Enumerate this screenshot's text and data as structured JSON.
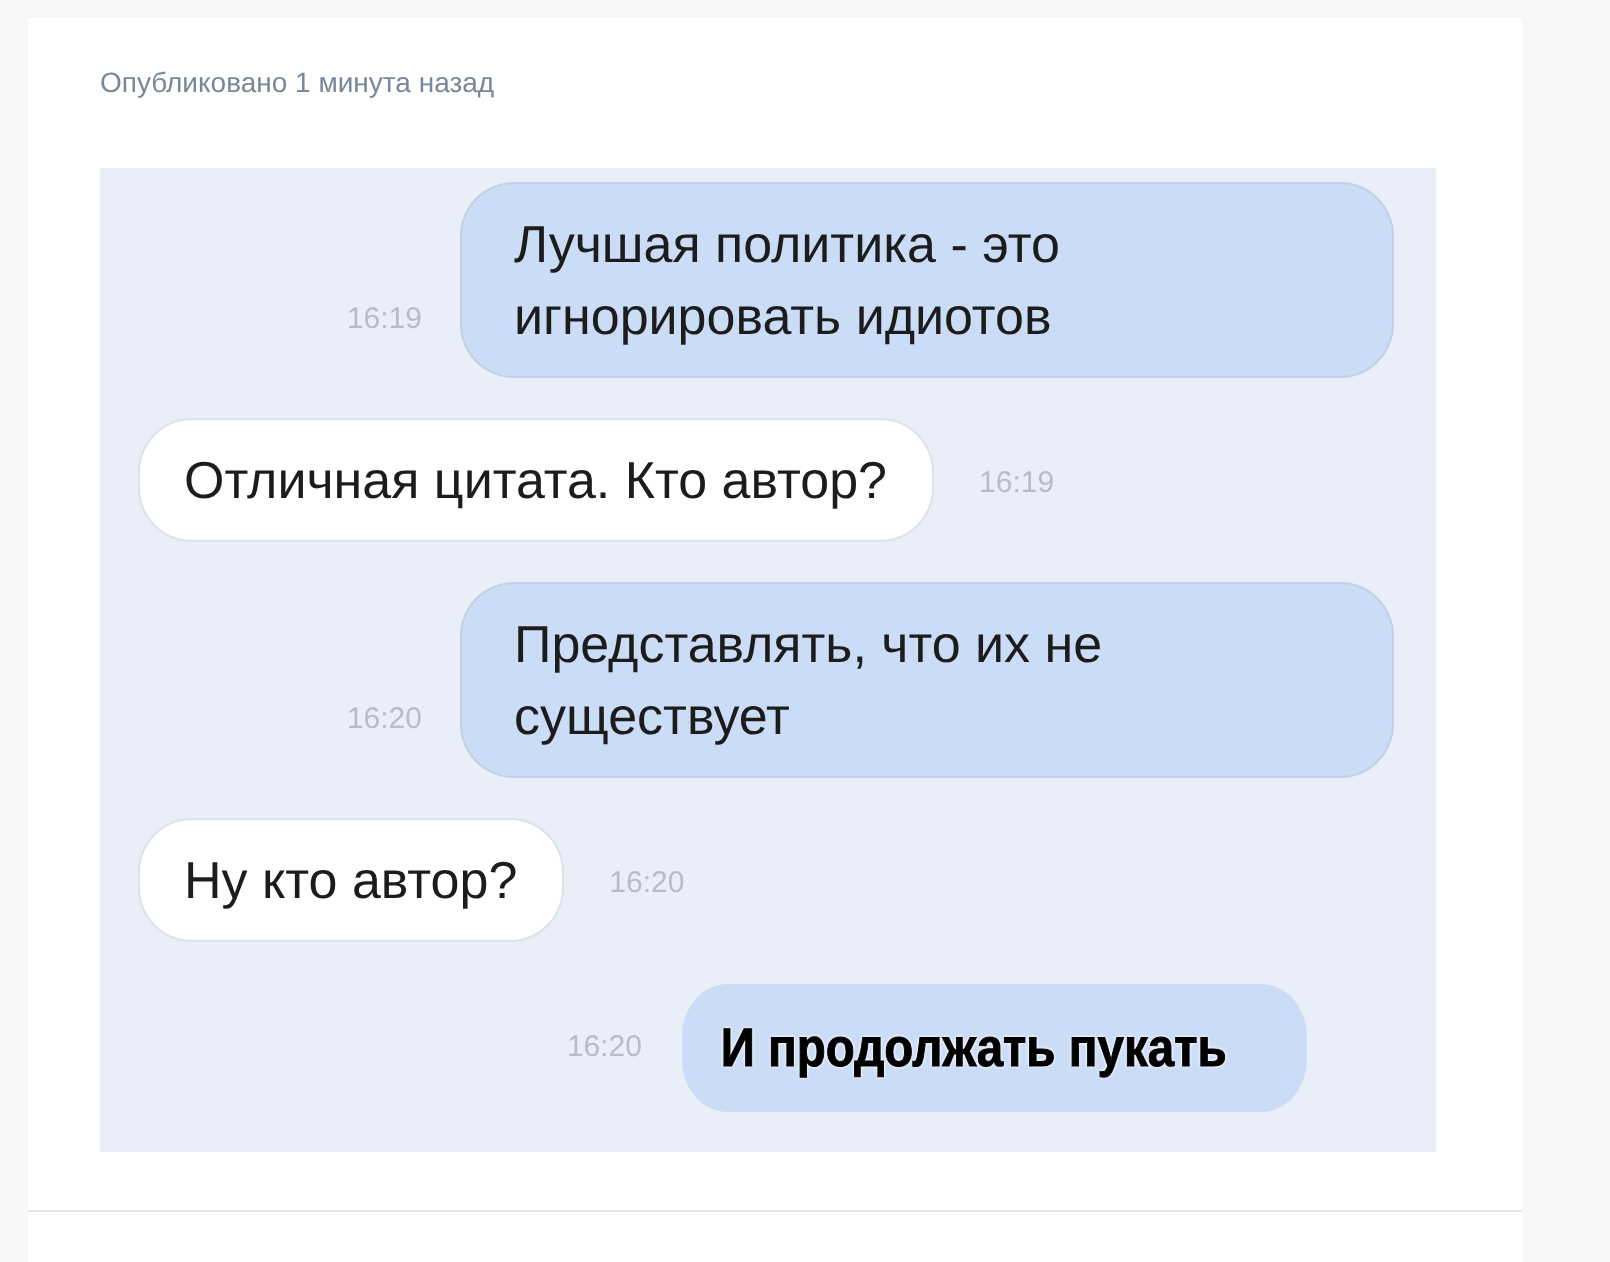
{
  "post": {
    "published": "Опубликовано 1 минута назад"
  },
  "messages": [
    {
      "kind": "sent",
      "text": "Лучшая политика - это игнорировать идиотов",
      "time": "16:19"
    },
    {
      "kind": "received",
      "text": "Отличная цитата. Кто автор?",
      "time": "16:19"
    },
    {
      "kind": "sent",
      "text": "Представлять, что их не существует",
      "time": "16:20"
    },
    {
      "kind": "received",
      "text": "Ну кто автор?",
      "time": "16:20"
    },
    {
      "kind": "caption",
      "text": "И продолжать пукать",
      "time": "16:20"
    }
  ]
}
